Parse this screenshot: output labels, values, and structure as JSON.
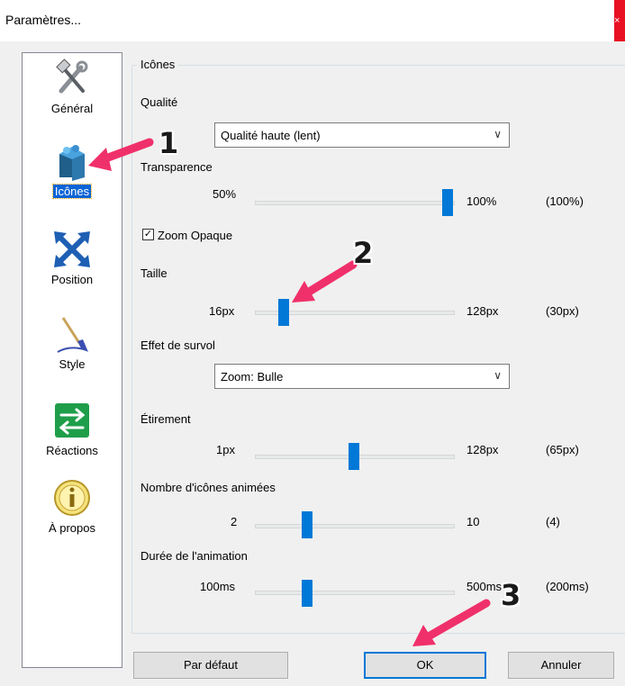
{
  "window": {
    "title": "Paramètres...",
    "close_glyph": "×"
  },
  "sidebar": {
    "items": [
      {
        "label": "Général",
        "icon": "tools-icon",
        "selected": false
      },
      {
        "label": "Icônes",
        "icon": "cube-icon",
        "selected": true
      },
      {
        "label": "Position",
        "icon": "move-arrows-icon",
        "selected": false
      },
      {
        "label": "Style",
        "icon": "paintbrush-icon",
        "selected": false
      },
      {
        "label": "Réactions",
        "icon": "swap-arrows-icon",
        "selected": false
      },
      {
        "label": "À propos",
        "icon": "info-icon",
        "selected": false
      }
    ]
  },
  "group": {
    "legend": "Icônes",
    "quality": {
      "label": "Qualité",
      "value": "Qualité haute (lent)"
    },
    "transparency": {
      "label": "Transparence",
      "min": "50%",
      "max": "100%",
      "current": "(100%)",
      "fraction": 1.0
    },
    "zoom_opaque": {
      "label": "Zoom Opaque",
      "checked": true,
      "check_glyph": "✓"
    },
    "size": {
      "label": "Taille",
      "min": "16px",
      "max": "128px",
      "current": "(30px)",
      "fraction": 0.125
    },
    "hover_effect": {
      "label": "Effet de survol",
      "value": "Zoom: Bulle"
    },
    "stretch": {
      "label": "Étirement",
      "min": "1px",
      "max": "128px",
      "current": "(65px)",
      "fraction": 0.5
    },
    "animated_count": {
      "label": "Nombre d'icônes animées",
      "min": "2",
      "max": "10",
      "current": "(4)",
      "fraction": 0.25
    },
    "anim_duration": {
      "label": "Durée de l'animation",
      "min": "100ms",
      "max": "500ms",
      "current": "(200ms)",
      "fraction": 0.25
    }
  },
  "buttons": {
    "default_label": "Par défaut",
    "ok_label": "OK",
    "cancel_label": "Annuler"
  },
  "annotations": [
    {
      "number": "1"
    },
    {
      "number": "2"
    },
    {
      "number": "3"
    }
  ],
  "colors": {
    "accent": "#0078d7",
    "selection": "#0a64d6",
    "arrow": "#f0306a",
    "close": "#e81123"
  }
}
